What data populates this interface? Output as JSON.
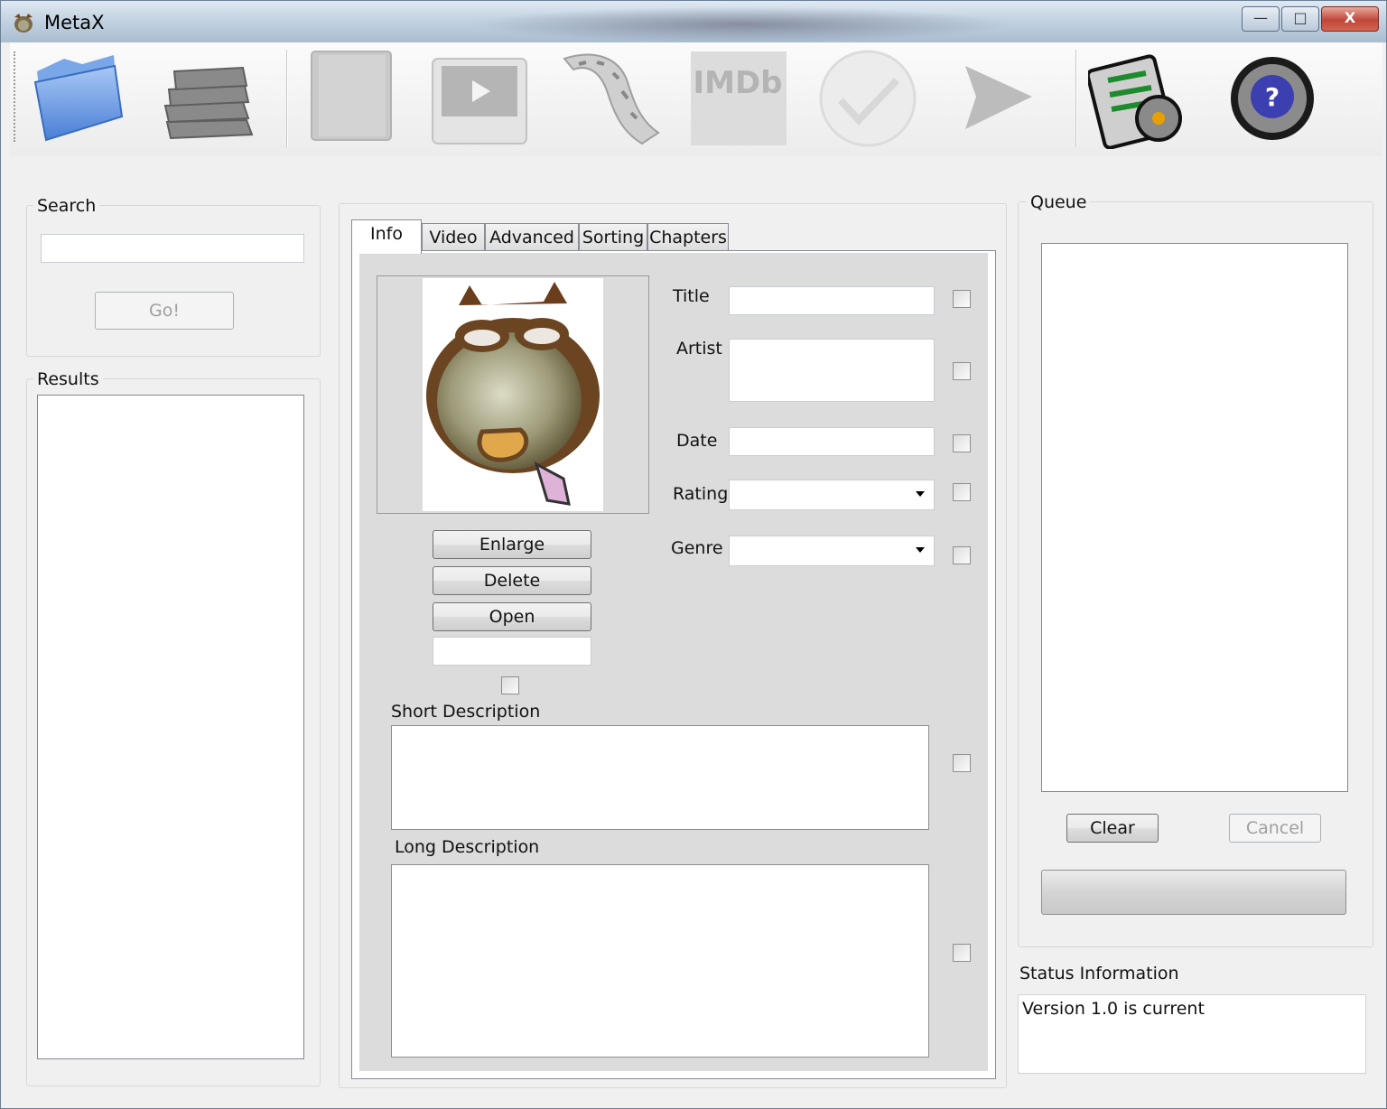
{
  "window": {
    "title": "MetaX",
    "minimize_label": "—",
    "maximize_label": "□",
    "close_label": "X"
  },
  "toolbar": {
    "items": [
      {
        "icon": "open-folder-icon",
        "enabled": true
      },
      {
        "icon": "books-stack-icon",
        "enabled": true
      },
      {
        "icon": "book-icon",
        "enabled": false
      },
      {
        "icon": "tv-icon",
        "enabled": false
      },
      {
        "icon": "film-strip-icon",
        "enabled": false
      },
      {
        "icon": "imdb-icon",
        "enabled": false,
        "label": "IMDb"
      },
      {
        "icon": "checkmark-icon",
        "enabled": false
      },
      {
        "icon": "play-arrow-icon",
        "enabled": false
      },
      {
        "icon": "options-icon",
        "enabled": true
      },
      {
        "icon": "help-icon",
        "enabled": true
      }
    ]
  },
  "search": {
    "group_label": "Search",
    "input_value": "",
    "go_label": "Go!"
  },
  "results": {
    "group_label": "Results",
    "items": []
  },
  "tabs": [
    {
      "label": "Info",
      "active": true
    },
    {
      "label": "Video",
      "active": false
    },
    {
      "label": "Advanced",
      "active": false
    },
    {
      "label": "Sorting",
      "active": false
    },
    {
      "label": "Chapters",
      "active": false
    }
  ],
  "info": {
    "artwork": {
      "enlarge_label": "Enlarge",
      "delete_label": "Delete",
      "open_label": "Open",
      "path_value": ""
    },
    "fields": {
      "title_label": "Title",
      "title_value": "",
      "artist_label": "Artist",
      "artist_value": "",
      "date_label": "Date",
      "date_value": "",
      "rating_label": "Rating",
      "rating_value": "",
      "genre_label": "Genre",
      "genre_value": ""
    },
    "short_description_label": "Short Description",
    "short_description_value": "",
    "long_description_label": "Long Description",
    "long_description_value": ""
  },
  "queue": {
    "group_label": "Queue",
    "items": [],
    "clear_label": "Clear",
    "cancel_label": "Cancel",
    "progress": 0
  },
  "status": {
    "label": "Status Information",
    "text": "Version 1.0 is current"
  }
}
